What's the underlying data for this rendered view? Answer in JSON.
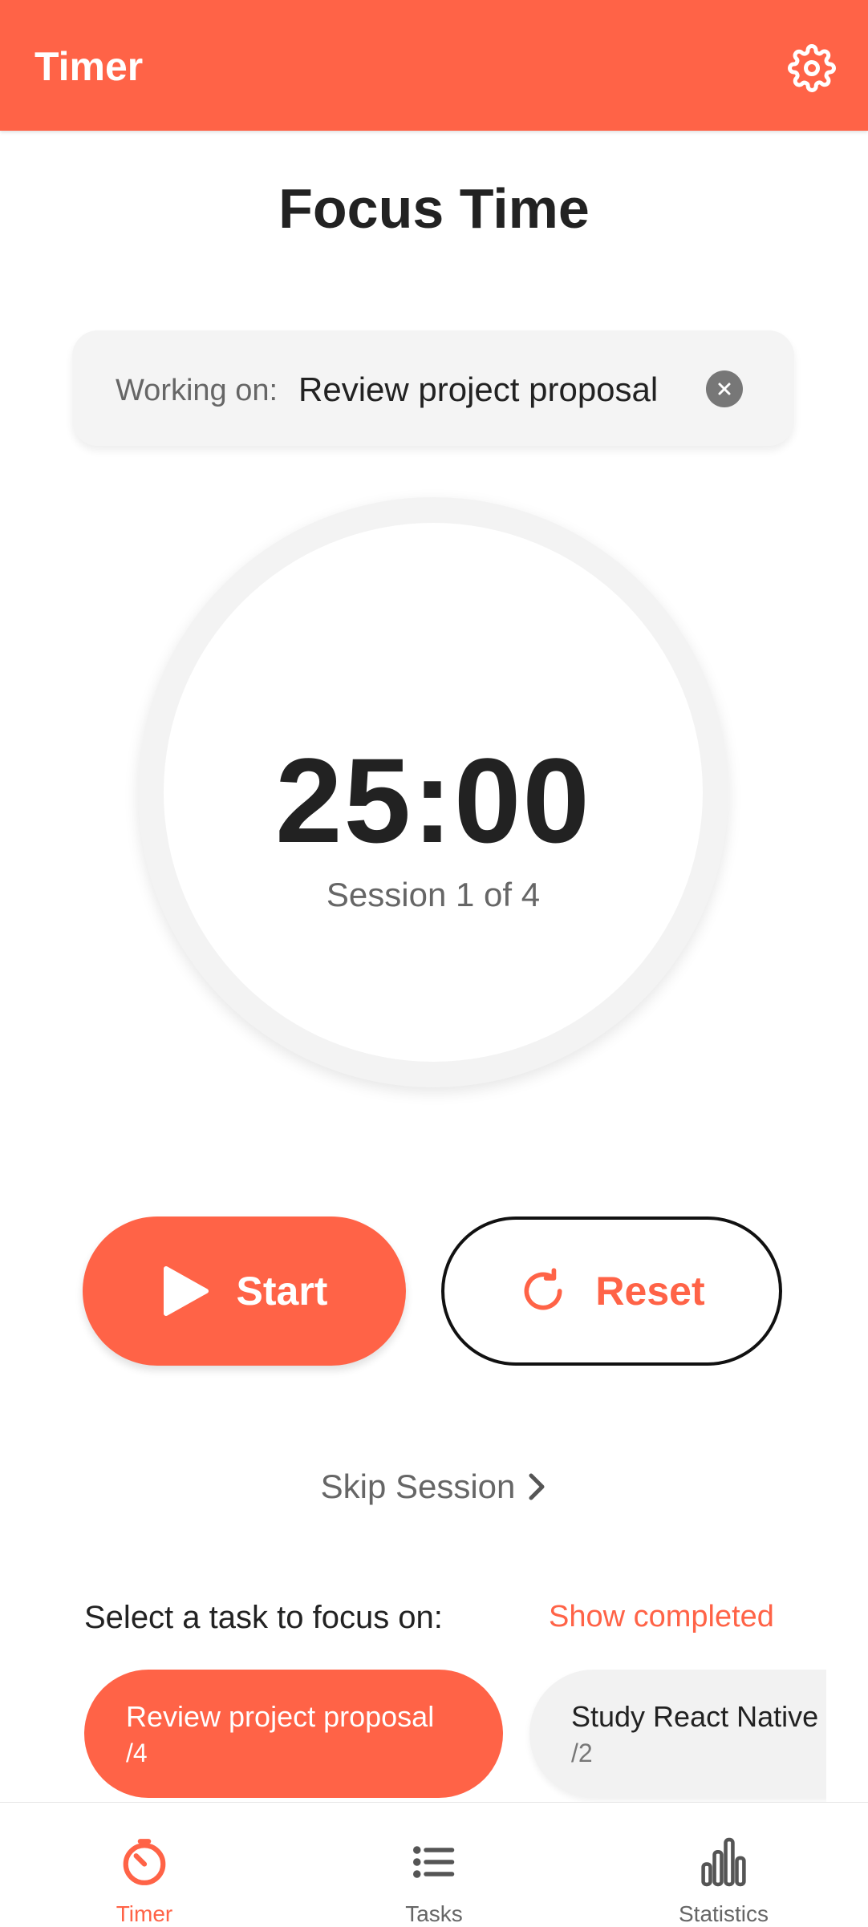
{
  "header": {
    "title": "Timer",
    "settings_icon": "gear-icon"
  },
  "page": {
    "title": "Focus Time"
  },
  "working_on": {
    "label": "Working on:",
    "task": "Review project proposal",
    "clear_icon": "close-icon"
  },
  "timer": {
    "time": "25:00",
    "session_text": "Session 1 of 4"
  },
  "controls": {
    "start_label": "Start",
    "start_icon": "play-icon",
    "reset_label": "Reset",
    "reset_icon": "refresh-icon",
    "skip_label": "Skip Session",
    "skip_icon": "chevron-right-icon"
  },
  "tasks": {
    "heading": "Select a task to focus on:",
    "show_completed": "Show completed",
    "items": [
      {
        "name": "Review project proposal",
        "count": "/4",
        "active": true
      },
      {
        "name": "Study React Native",
        "count": "/2",
        "active": false
      }
    ]
  },
  "nav": {
    "items": [
      {
        "label": "Timer",
        "icon": "timer-icon",
        "active": true
      },
      {
        "label": "Tasks",
        "icon": "list-icon",
        "active": false
      },
      {
        "label": "Statistics",
        "icon": "bar-chart-icon",
        "active": false
      }
    ]
  },
  "colors": {
    "accent": "#FF6347",
    "text": "#222222",
    "muted": "#666666"
  }
}
